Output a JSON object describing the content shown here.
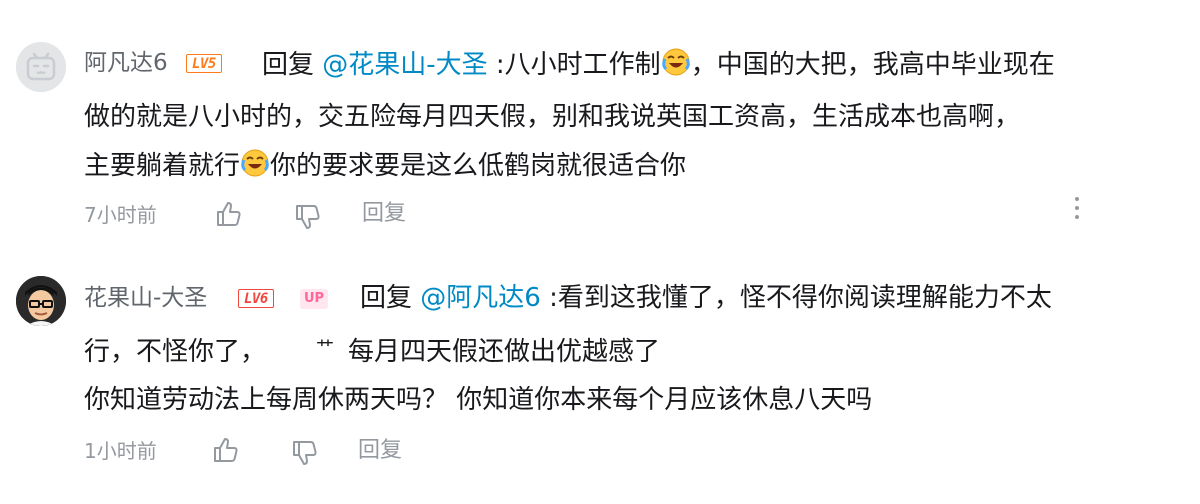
{
  "comments": [
    {
      "username": "阿凡达6",
      "level": "LV5",
      "reply_prefix": "回复 ",
      "mention": "@花果山-大圣",
      "lines": {
        "l1a": " :八小时工作制",
        "l1b": "，中国的大把，我高中毕业现在",
        "l2": "做的就是八小时的，交五险每月四天假，别和我说英国工资高，生活成本也高啊，",
        "l3a": "主要躺着就行",
        "l3b": "你的要求要是这么低鹤岗就很适合你"
      },
      "time": "7小时前",
      "reply_label": "回复"
    },
    {
      "username": "花果山-大圣",
      "level": "LV6",
      "up_badge": "UP",
      "reply_prefix": "回复 ",
      "mention": "@阿凡达6",
      "lines": {
        "l1": " :看到这我懂了，怪不得你阅读理解能力不太",
        "l2a": "行，不怪你了，",
        "l2sym": "艹",
        "l2b": "每月四天假还做出优越感了",
        "l3": "你知道劳动法上每周休两天吗？ 你知道你本来每个月应该休息八天吗"
      },
      "time": "1小时前",
      "reply_label": "回复"
    }
  ],
  "icons": [
    "like-icon",
    "dislike-icon",
    "more-icon",
    "crying-laugh-emoji"
  ],
  "colors": {
    "mention": "#008ac5",
    "meta": "#9499a0",
    "lv5": "#ff7a1a",
    "lv6": "#f0473f",
    "up": "#ff6699"
  }
}
